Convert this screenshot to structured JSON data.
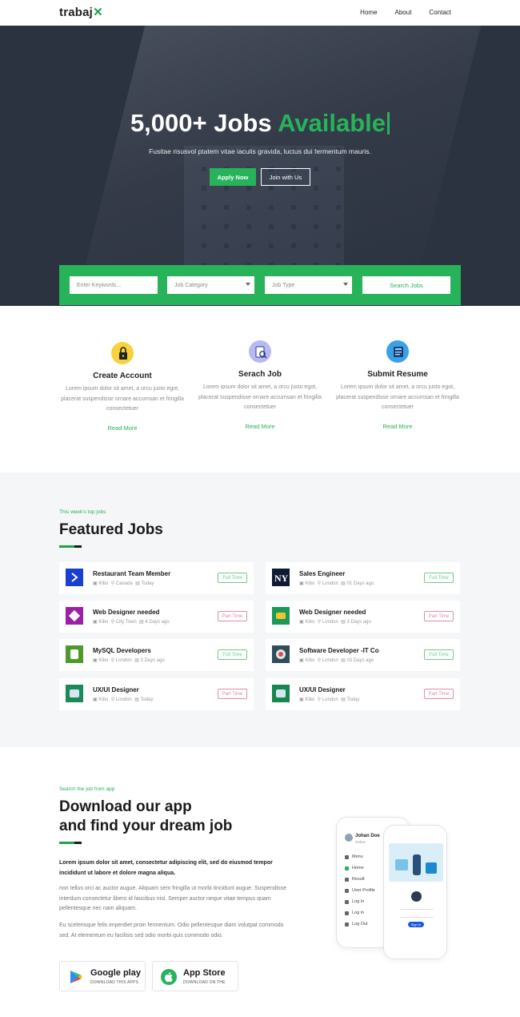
{
  "nav": {
    "logo": "trabaj",
    "items": [
      "Home",
      "About",
      "Contact"
    ]
  },
  "hero": {
    "title_main": "5,000+ Jobs",
    "title_accent": "Available",
    "subtitle": "Fusitae risusvol ptatem vitae iaculis gravida, luctus dui fermentum mauris.",
    "apply_label": "Apply Now",
    "join_label": "Join with Us"
  },
  "search": {
    "keywords_placeholder": "Enter Keywords...",
    "category_label": "Job Category",
    "type_label": "Job Type",
    "button_label": "Search Jobs"
  },
  "steps": [
    {
      "title": "Create Account",
      "text": "Lorem ipsum dolor sit amet, a orcu justo egot, placerat suspendisse ornare accumsan et fringilla consectetuer",
      "link": "Read More"
    },
    {
      "title": "Serach Job",
      "text": "Lorem ipsum dolor sit amet, a orcu justo egot, placerat suspendisse ornare accumsan et fringilla consectetuer",
      "link": "Read More"
    },
    {
      "title": "Submit Resume",
      "text": "Lorem ipsum dolor sit amet, a orcu justo egot, placerat suspendisse ornare accumsan et fringilla consectetuer",
      "link": "Read More"
    }
  ],
  "featured": {
    "kicker": "This week's top jobs",
    "title": "Featured Jobs",
    "jobs": [
      {
        "title": "Restaurant Team Member",
        "company": "Kibo",
        "location": "Canada",
        "date": "Today",
        "type": "Full Time",
        "color": "#1b3fd1"
      },
      {
        "title": "Sales Engineer",
        "company": "Kibo",
        "location": "London",
        "date": "01 Days ago",
        "type": "Full Time",
        "color": "#0e1b33"
      },
      {
        "title": "Web Designer needed",
        "company": "Kibo",
        "location": "City Town",
        "date": "4 Days ago",
        "type": "Part Time",
        "color": "#9c1fa6"
      },
      {
        "title": "Web Designer needed",
        "company": "Kibo",
        "location": "London",
        "date": "3 Days ago",
        "type": "Part Time",
        "color": "#1a9a56"
      },
      {
        "title": "MySQL Developers",
        "company": "Kibo",
        "location": "London",
        "date": "3 Days ago",
        "type": "Full Time",
        "color": "#4c9a2a"
      },
      {
        "title": "Software Developer -IT Co",
        "company": "Kibo",
        "location": "London",
        "date": "03 Days ago",
        "type": "Full Time",
        "color": "#2f4d5a"
      },
      {
        "title": "UX/UI Designer",
        "company": "Kibo",
        "location": "London",
        "date": "Today",
        "type": "Part Time",
        "color": "#1a8a5a"
      },
      {
        "title": "UX/UI Designer",
        "company": "Kibo",
        "location": "London",
        "date": "Today",
        "type": "Part Time",
        "color": "#17864f"
      }
    ]
  },
  "app": {
    "kicker": "Search the job from app",
    "title_line1": "Download our app",
    "title_line2": "and find your dream job",
    "lead": "Lorem ipsum dolor sit amet, consectetur adipiscing elit, sed do eiusmod tempor incididunt ut labore et dolore magna aliqua.",
    "para1": "non tellus orci ac auctor augue. Aliquam sem fringilla ut morbi tincidunt augue. Suspendisse interdum consectetur libero id faucibus nisl. Semper auctor neque vitae tempus quam pellentesque nec nam aliquam.",
    "para2": "Eu scelerisque felis imperdiet proin fermentum. Odio pellentesque diam volutpat commodo sed. At elementum eu facilisis sed odio morbi quis commodo odio.",
    "google_title": "Google play",
    "google_sub": "DOWNLOAD THIS APPS",
    "apple_title": "App Store",
    "apple_sub": "DOWNLOAD ON THE",
    "phone_user": "Johan Doe",
    "phone_user_sub": "Online",
    "phone_menu": [
      "Menu",
      "Home",
      "Result",
      "User Profile",
      "Log In",
      "Log in",
      "Log Out"
    ],
    "phone_login": "Sign In"
  },
  "colors": {
    "accent": "#27b35a",
    "hero_bg": "#2c3340"
  }
}
